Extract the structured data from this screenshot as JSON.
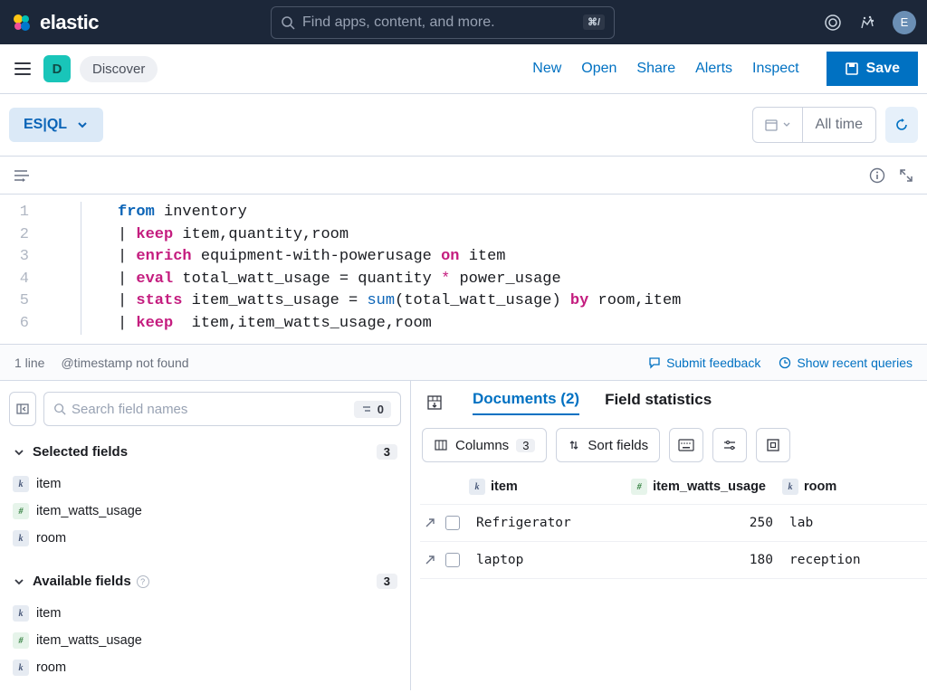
{
  "brand": "elastic",
  "search": {
    "placeholder": "Find apps, content, and more.",
    "shortcut": "⌘/"
  },
  "user": {
    "initial": "E"
  },
  "app_badge": "D",
  "breadcrumb": "Discover",
  "actions": {
    "new": "New",
    "open": "Open",
    "share": "Share",
    "alerts": "Alerts",
    "inspect": "Inspect",
    "save": "Save"
  },
  "lang_badge": "ES|QL",
  "time": "All time",
  "code_lines": [
    "1",
    "2",
    "3",
    "4",
    "5",
    "6"
  ],
  "code": {
    "from": "from",
    "table": "inventory",
    "keep1": "keep",
    "keep1_args": "item,quantity,room",
    "enrich": "enrich",
    "enrich_args1": "equipment-with-powerusage",
    "on": "on",
    "enrich_args2": "item",
    "eval": "eval",
    "eval_expr1": "total_watt_usage = quantity",
    "star": "*",
    "eval_expr2": "power_usage",
    "stats": "stats",
    "stats_expr1": "item_watts_usage =",
    "sum": "sum",
    "stats_expr2": "(total_watt_usage)",
    "by": "by",
    "stats_expr3": "room,item",
    "keep2": "keep",
    "keep2_args": "item,item_watts_usage,room"
  },
  "status": {
    "lines": "1 line",
    "ts": "@timestamp not found",
    "feedback": "Submit feedback",
    "recent": "Show recent queries"
  },
  "fields_search": {
    "placeholder": "Search field names",
    "filter_count": "0"
  },
  "selected": {
    "title": "Selected fields",
    "count": "3",
    "items": [
      {
        "type": "k",
        "name": "item"
      },
      {
        "type": "n",
        "name": "item_watts_usage"
      },
      {
        "type": "k",
        "name": "room"
      }
    ]
  },
  "available": {
    "title": "Available fields",
    "count": "3",
    "items": [
      {
        "type": "k",
        "name": "item"
      },
      {
        "type": "n",
        "name": "item_watts_usage"
      },
      {
        "type": "k",
        "name": "room"
      }
    ]
  },
  "tabs": {
    "documents": "Documents (2)",
    "fieldstats": "Field statistics"
  },
  "columns": {
    "label": "Columns",
    "count": "3",
    "sort": "Sort fields"
  },
  "table": {
    "headers": {
      "item": "item",
      "watts": "item_watts_usage",
      "room": "room"
    },
    "rows": [
      {
        "item": "Refrigerator",
        "watts": "250",
        "room": "lab"
      },
      {
        "item": "laptop",
        "watts": "180",
        "room": "reception"
      }
    ]
  }
}
